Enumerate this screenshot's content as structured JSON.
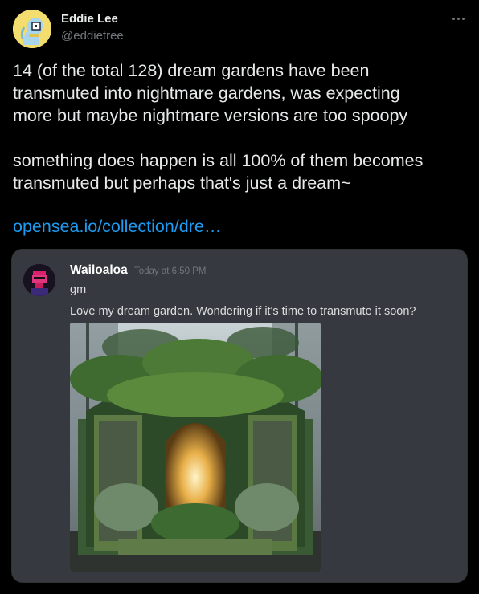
{
  "author": {
    "name": "Eddie Lee",
    "handle": "@eddietree"
  },
  "tweet": {
    "paragraphs": [
      [
        "14 (of the total 128) dream gardens have been",
        "transmuted into nightmare gardens, was expecting",
        "more but maybe nightmare versions are too spoopy"
      ],
      [
        "something does happen is all 100% of them becomes",
        "transmuted but perhaps that's just a dream~"
      ]
    ],
    "link": "opensea.io/collection/dre…"
  },
  "embed": {
    "username": "Wailoaloa",
    "timestamp": "Today at 6:50 PM",
    "messages": [
      "gm",
      "Love my dream garden. Wondering if it's time to transmute it soon?"
    ]
  },
  "colors": {
    "background": "#000000",
    "text": "#e7e9ea",
    "muted": "#71767b",
    "link": "#1d9bf0",
    "card": "#36393f"
  },
  "icons": {
    "more": "more-icon"
  }
}
